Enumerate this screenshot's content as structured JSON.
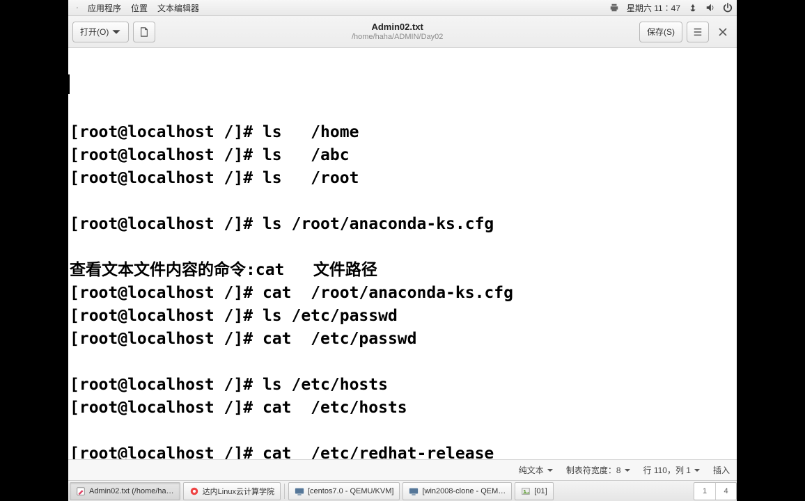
{
  "topbar": {
    "menu_apps": "应用程序",
    "menu_places": "位置",
    "menu_editor": "文本编辑器",
    "clock": "星期六 11∶47"
  },
  "toolbar": {
    "open_label": "打开(O)",
    "save_label": "保存(S)"
  },
  "title": {
    "filename": "Admin02.txt",
    "filepath": "/home/haha/ADMIN/Day02"
  },
  "editor_lines": [
    "[root@localhost /]# ls   /home",
    "[root@localhost /]# ls   /abc",
    "[root@localhost /]# ls   /root",
    "",
    "[root@localhost /]# ls /root/anaconda-ks.cfg",
    "",
    "查看文本文件内容的命令:cat   文件路径",
    "[root@localhost /]# cat  /root/anaconda-ks.cfg",
    "[root@localhost /]# ls /etc/passwd",
    "[root@localhost /]# cat  /etc/passwd",
    "",
    "[root@localhost /]# ls /etc/hosts",
    "[root@localhost /]# cat  /etc/hosts",
    "",
    "[root@localhost /]# cat  /etc/redhat-release"
  ],
  "statusbar": {
    "syntax": "纯文本",
    "tab_width": "制表符宽度：8",
    "position": "行 110，列 1",
    "insert_mode": "插入"
  },
  "taskbar": {
    "items": [
      {
        "label": "Admin02.txt (/home/ha…"
      },
      {
        "label": "达内Linux云计算学院"
      },
      {
        "label": "[centos7.0 - QEMU/KVM]"
      },
      {
        "label": "[win2008-clone - QEM…"
      },
      {
        "label": "[01]"
      }
    ],
    "pager": [
      "1",
      "4"
    ]
  }
}
